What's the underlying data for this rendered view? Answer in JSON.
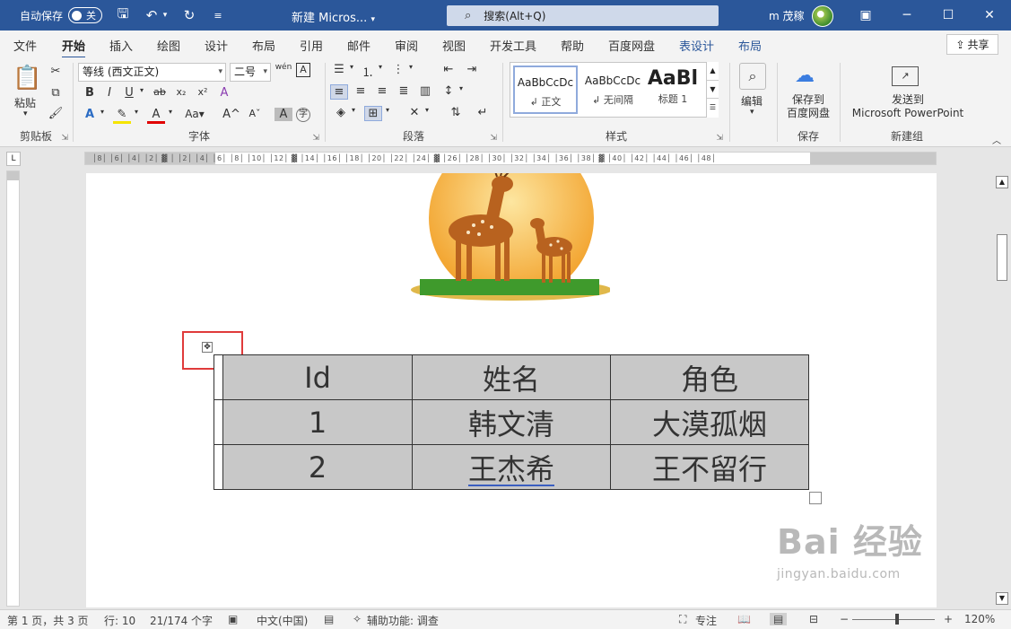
{
  "titlebar": {
    "autosave_label": "自动保存",
    "autosave_state": "关",
    "doc_title": "新建 Micros...",
    "search_placeholder": "搜索(Alt+Q)",
    "user": "m 茂稼"
  },
  "tabs": [
    "文件",
    "开始",
    "插入",
    "绘图",
    "设计",
    "布局",
    "引用",
    "邮件",
    "审阅",
    "视图",
    "开发工具",
    "帮助",
    "百度网盘",
    "表设计",
    "布局"
  ],
  "share_label": "共享",
  "ribbon": {
    "clipboard": {
      "paste": "粘贴",
      "label": "剪贴板"
    },
    "font": {
      "name": "等线 (西文正文)",
      "size": "二号",
      "label": "字体"
    },
    "paragraph": {
      "label": "段落"
    },
    "styles": {
      "label": "样式",
      "items": [
        {
          "sample": "AaBbCcDc",
          "name": "↲ 正文"
        },
        {
          "sample": "AaBbCcDc",
          "name": "↲ 无间隔"
        },
        {
          "sample": "AaBl",
          "name": "标题 1"
        }
      ]
    },
    "editing": {
      "label": "编辑"
    },
    "save": {
      "button": "保存到\n百度网盘",
      "label": "保存"
    },
    "newgroup": {
      "button": "发送到\nMicrosoft PowerPoint",
      "label": "新建组"
    }
  },
  "ruler": {
    "h_ticks": "│8│ │6│ │4│ │2│  ▓  │ │2│ │4│ │6│ │8│ │10│ │12│ ▓ │14│ │16│ │18│ │20│ │22│ │24│ ▓ │26│ │28│ │30│ │32│ │34│ │36│ │38│ ▓ │40│ │42│ │44│ │46│ │48│"
  },
  "table": {
    "headers": [
      "Id",
      "姓名",
      "角色"
    ],
    "rows": [
      [
        "1",
        "韩文清",
        "大漠孤烟"
      ],
      [
        "2",
        "王杰希",
        "王不留行"
      ]
    ]
  },
  "watermark": {
    "logo": "Bai 经验",
    "url": "jingyan.baidu.com"
  },
  "statusbar": {
    "page": "第 1 页，共 3 页",
    "line": "行: 10",
    "words": "21/174 个字",
    "language": "中文(中国)",
    "accessibility": "辅助功能: 调查",
    "focus": "专注",
    "zoom": "120%"
  },
  "colors": {
    "accent": "#2b579a",
    "highlight_box": "#e03b3b",
    "table_fill": "#c8c8c8"
  }
}
